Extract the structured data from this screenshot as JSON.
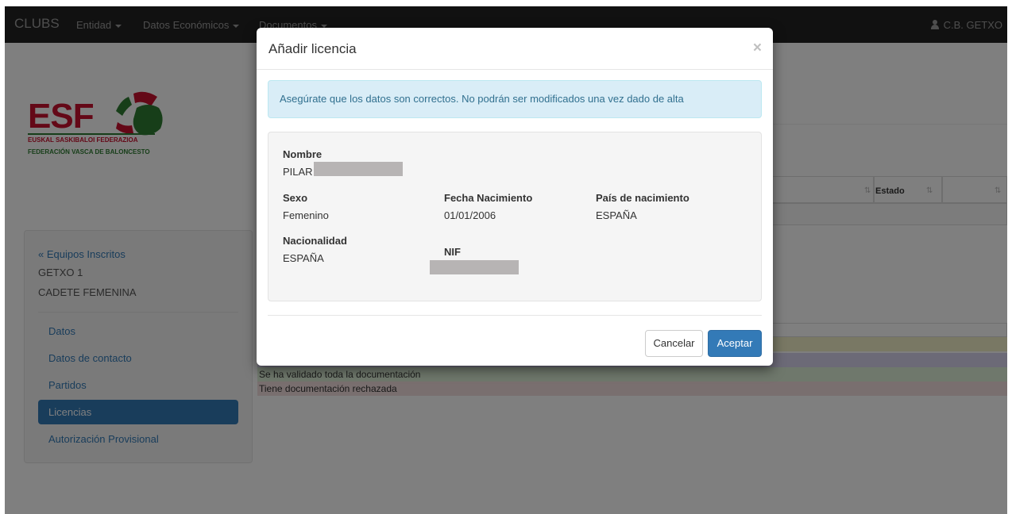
{
  "navbar": {
    "brand": "CLUBS",
    "items": [
      "Entidad",
      "Datos Económicos",
      "Documentos"
    ],
    "user": "C.B. GETXO"
  },
  "logo": {
    "text": "ESF",
    "sub1": "EUSKAL SASKIBALOI FEDERAZIOA",
    "sub2": "FEDERACIÓN VASCA DE BALONCESTO"
  },
  "sidebar": {
    "back_link": "« Equipos Inscritos",
    "team": "GETXO 1",
    "category": "CADETE FEMENINA",
    "items": [
      "Datos",
      "Datos de contacto",
      "Partidos",
      "Licencias",
      "Autorización Provisional"
    ],
    "active_index": 3
  },
  "background": {
    "table_header_estado": "Estado",
    "legend": [
      {
        "text": "",
        "color": "#f2f0c8"
      },
      {
        "text": "",
        "color": "#d8d4ef"
      },
      {
        "text": "Se ha validado toda la documentación",
        "color": "#dff0d8"
      },
      {
        "text": "Tiene documentación rechazada",
        "color": "#f2dede"
      }
    ]
  },
  "modal": {
    "title": "Añadir licencia",
    "close": "×",
    "alert": "Asegúrate que los datos son correctos. No podrán ser modificados una vez dado de alta",
    "fields": {
      "nombre_label": "Nombre",
      "nombre_value": "PILAR",
      "sexo_label": "Sexo",
      "sexo_value": "Femenino",
      "fecha_label": "Fecha Nacimiento",
      "fecha_value": "01/01/2006",
      "pais_label": "País de nacimiento",
      "pais_value": "ESPAÑA",
      "nacionalidad_label": "Nacionalidad",
      "nacionalidad_value": "ESPAÑA",
      "nif_label": "NIF"
    },
    "cancel_label": "Cancelar",
    "accept_label": "Aceptar"
  },
  "colors": {
    "primary": "#337ab7",
    "navbar": "#222222",
    "alert_bg": "#d9edf7"
  }
}
